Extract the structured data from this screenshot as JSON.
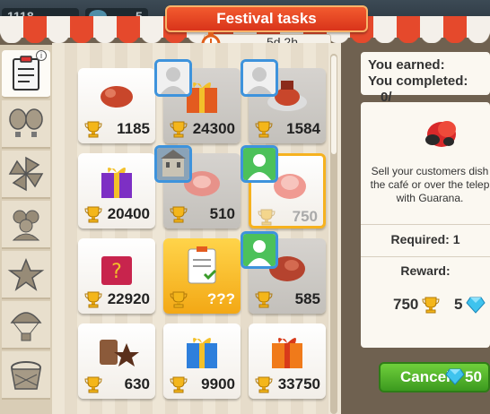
{
  "currency": {
    "coins": "1118",
    "gems_partial": "5"
  },
  "header": {
    "title": "Festival tasks",
    "timer": "5d 2h"
  },
  "sidebar": {
    "info_icon": "i",
    "tabs": [
      "clipboard-icon",
      "balloons-icon",
      "pinwheel-icon",
      "people-icon",
      "laurel-star-icon",
      "parachute-icon",
      "basket-icon"
    ]
  },
  "grid": {
    "tiles": [
      {
        "item": "sausage",
        "value": "1185",
        "style": "white"
      },
      {
        "item": "gift",
        "value": "24300",
        "style": "grey"
      },
      {
        "item": "platter",
        "value": "1584",
        "style": "grey"
      },
      {
        "item": "purple-gift",
        "value": "20400",
        "style": "white"
      },
      {
        "item": "ham",
        "value": "510",
        "style": "grey"
      },
      {
        "item": "meat",
        "value": "750",
        "style": "selected"
      },
      {
        "item": "mystery-gift",
        "value": "22920",
        "style": "white"
      },
      {
        "item": "task-card",
        "value": "???",
        "style": "gold"
      },
      {
        "item": "steak",
        "value": "585",
        "style": "grey"
      },
      {
        "item": "coffee-anise",
        "value": "630",
        "style": "white"
      },
      {
        "item": "blue-gift",
        "value": "9900",
        "style": "white"
      },
      {
        "item": "orange-gift",
        "value": "33750",
        "style": "white"
      }
    ]
  },
  "panel": {
    "earned_label": "You earned:",
    "completed_label": "You completed:",
    "completed_value": "0/",
    "description": "Sell your customers dish the café or over the telep with Guarana.",
    "required": "Required: 1",
    "reward_label": "Reward:",
    "reward_points": "750",
    "reward_gems": "5",
    "cancel_label": "Cancel",
    "cancel_cost": "50"
  },
  "colors": {
    "accent": "#e5492c",
    "gold": "#f3a815",
    "green": "#4fae2a",
    "badge_blue": "#3e93dc"
  }
}
